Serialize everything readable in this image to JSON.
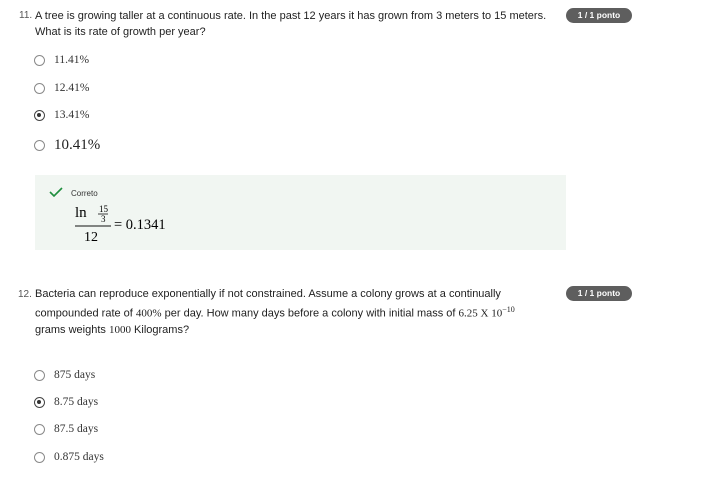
{
  "q11": {
    "number": "11.",
    "text_line1": "A tree is growing taller at a continuous rate. In the past 12 years it has grown from 3 meters to 15 meters.",
    "text_line2": "What is its rate of growth per year?",
    "badge": "1 / 1 ponto",
    "options": [
      "11.41%",
      "12.41%",
      "13.41%",
      "10.41%"
    ],
    "selected_index": 2,
    "feedback": {
      "title": "Correto",
      "ln": "ln",
      "num": "15",
      "den": "3",
      "divisor": "12",
      "result": "= 0.1341"
    }
  },
  "q12": {
    "number": "12.",
    "text_line1": "Bacteria can reproduce exponentially if not constrained. Assume a colony grows at a continually",
    "text_line2a": "compounded rate of ",
    "text_line2b": "400%",
    "text_line2c": " per day. How many days before a colony with initial mass of ",
    "text_line2d": "6.25 X 10",
    "text_line2e": "−10",
    "text_line3a": "grams weights ",
    "text_line3b": "1000",
    "text_line3c": " Kilograms?",
    "badge": "1 / 1 ponto",
    "options": [
      "875 days",
      "8.75 days",
      "87.5 days",
      "0.875 days"
    ],
    "selected_index": 1
  },
  "colors": {
    "badge_bg": "#5e5e5e",
    "feedback_bg": "#f1f6f2",
    "check_green": "#1e8e3e"
  }
}
